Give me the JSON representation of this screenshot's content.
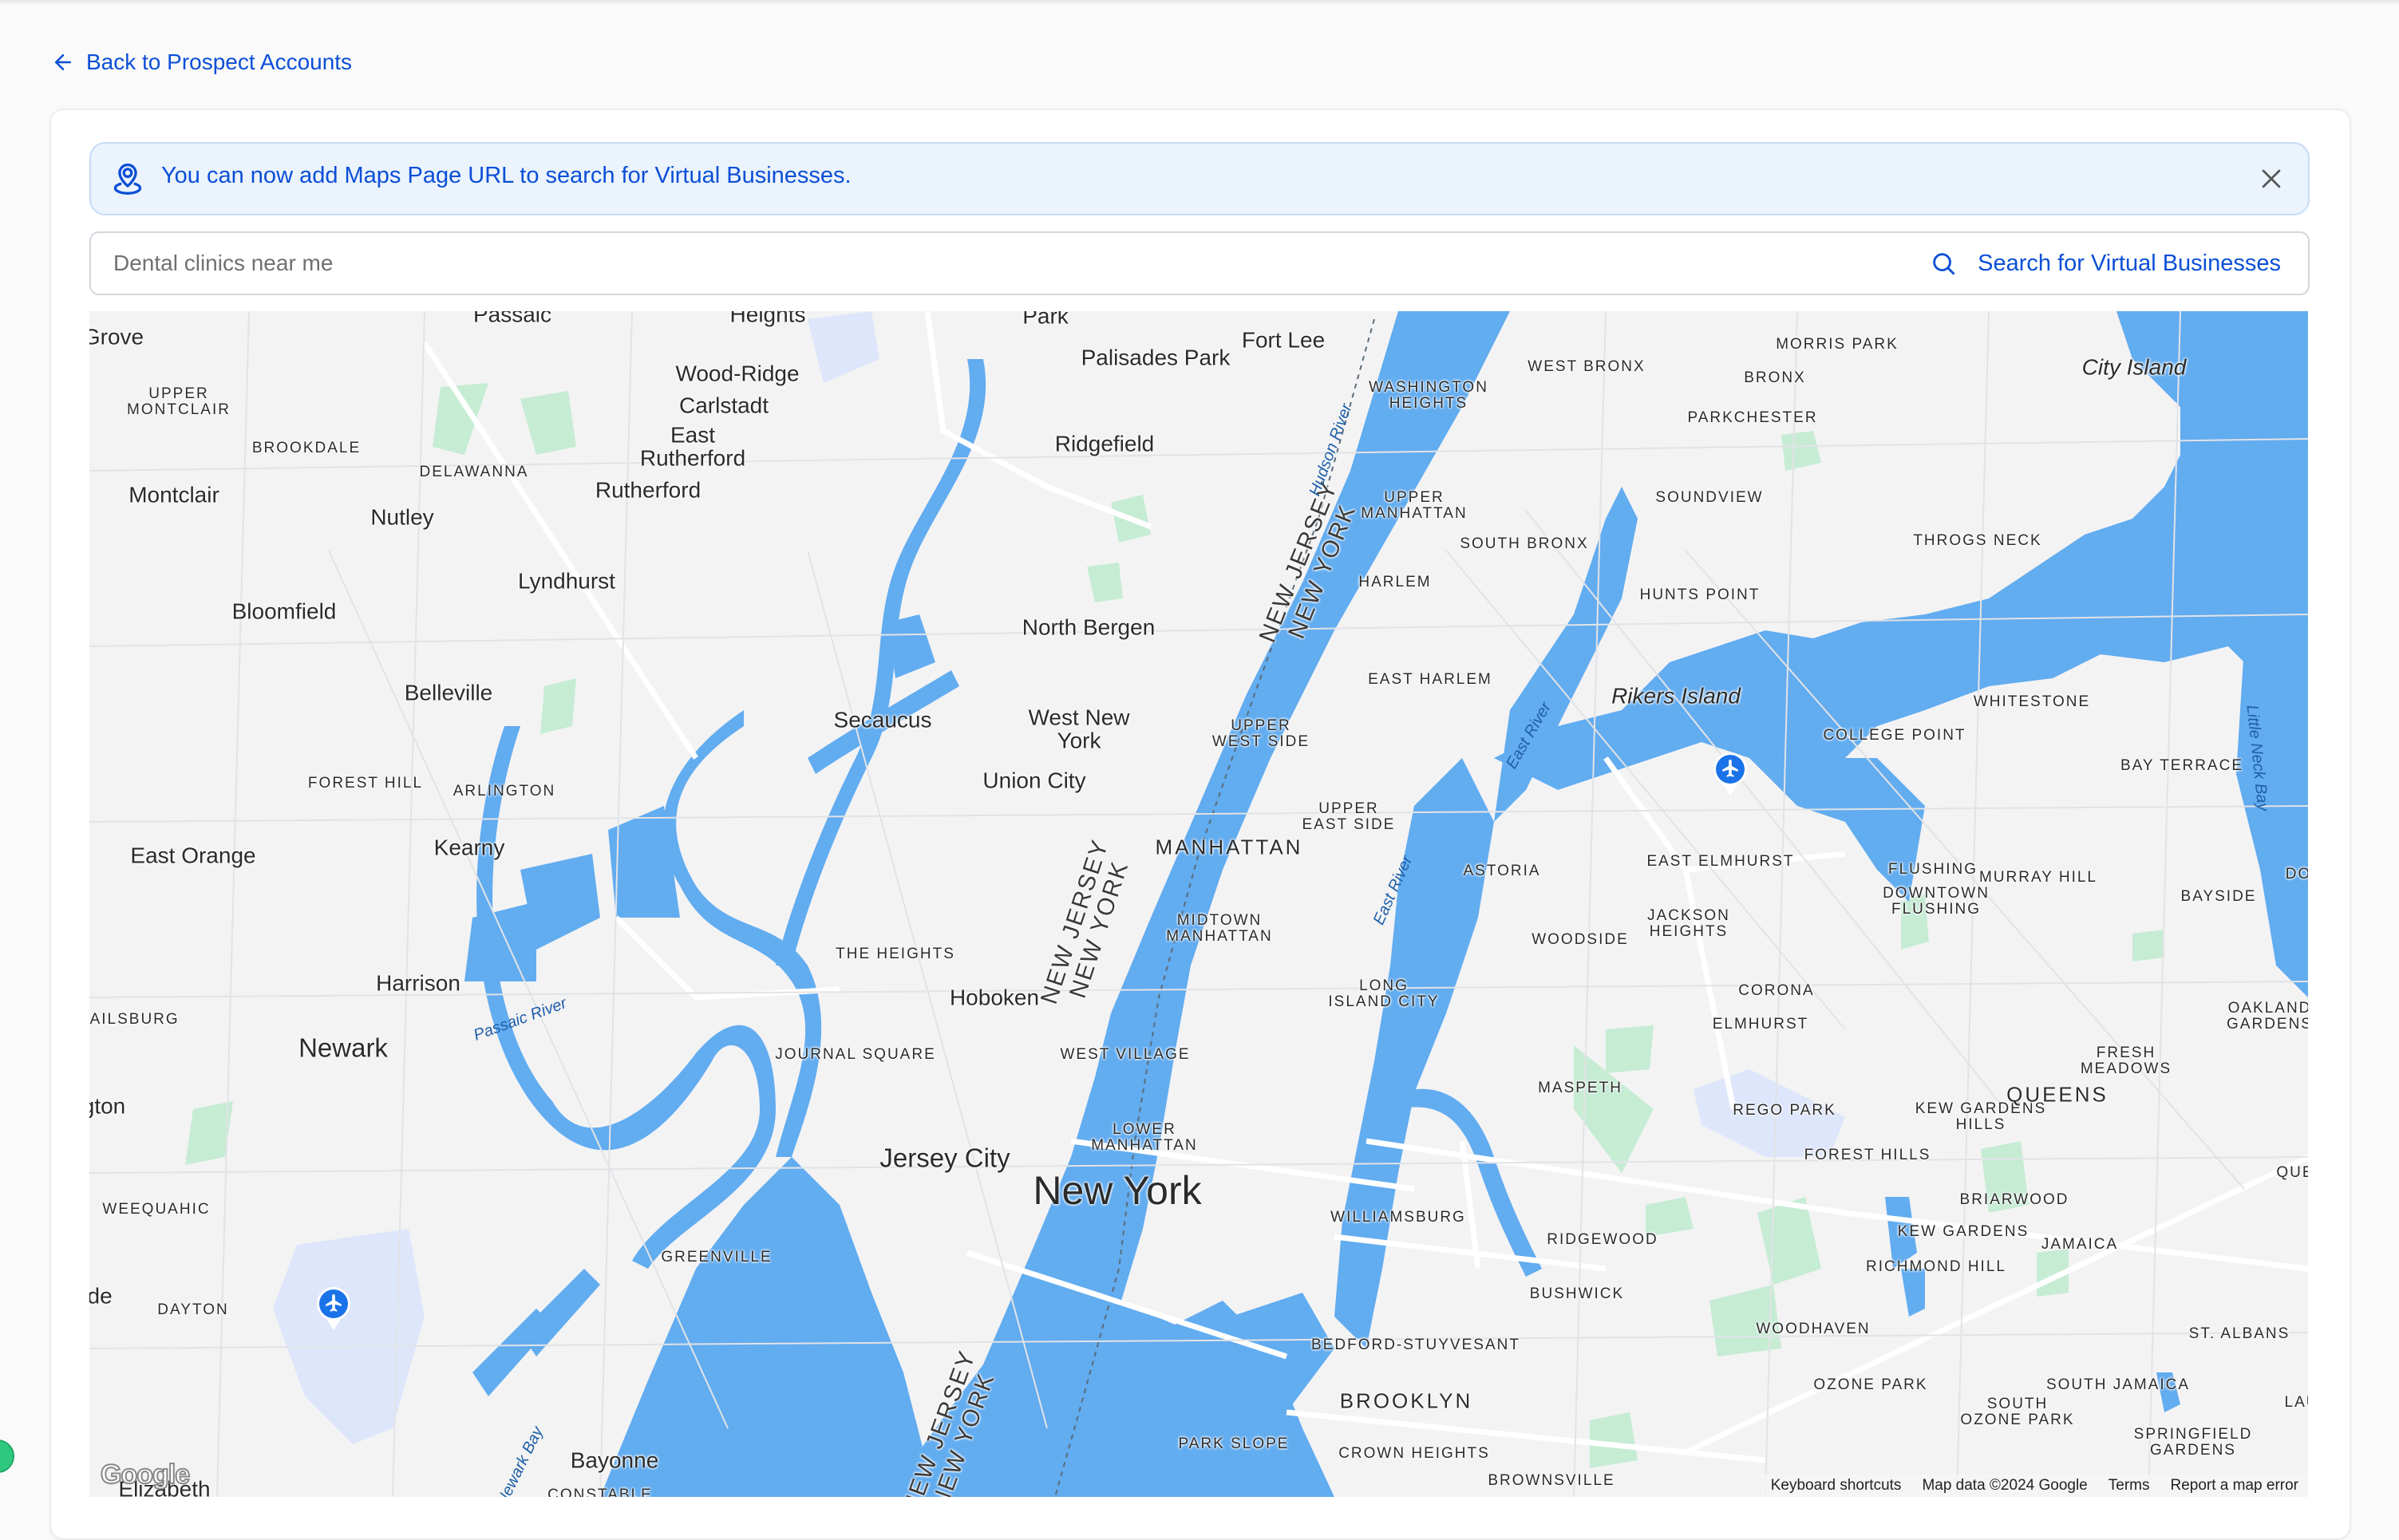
{
  "nav": {
    "back_label": "Back to Prospect Accounts"
  },
  "banner": {
    "message": "You can now add Maps Page URL to search for Virtual Businesses.",
    "icon": "map-pin-user-icon"
  },
  "search": {
    "value": "",
    "placeholder": "Dental clinics near me",
    "button_label": "Search for Virtual Businesses"
  },
  "colors": {
    "accent": "#0b4fd6",
    "banner_bg": "#ebf3fd",
    "water": "#62acf0",
    "land": "#f3f3f4",
    "park": "#c6ecd4",
    "airport": "#1a73e8"
  },
  "map": {
    "attribution": {
      "logo": "Google",
      "keyboard_shortcuts": "Keyboard shortcuts",
      "map_data": "Map data ©2024 Google",
      "terms": "Terms",
      "report": "Report a map error"
    },
    "labels": {
      "grove": "Grove",
      "passaic": "Passaic",
      "heights": "Heights",
      "park": "Park",
      "palisades_park": "Palisades Park",
      "fort_lee": "Fort Lee",
      "wood_ridge": "Wood-Ridge",
      "carlstadt": "Carlstadt",
      "east_rutherford": "East\nRutherford",
      "rutherford": "Rutherford",
      "ridgefield": "Ridgefield",
      "upper_montclair": "UPPER\nMONTCLAIR",
      "brookdale": "BROOKDALE",
      "delawanna": "DELAWANNA",
      "montclair": "Montclair",
      "nutley": "Nutley",
      "lyndhurst": "Lyndhurst",
      "bloomfield": "Bloomfield",
      "north_bergen": "North Bergen",
      "belleville": "Belleville",
      "secaucus": "Secaucus",
      "west_new_york": "West New\nYork",
      "union_city": "Union City",
      "forest_hill": "FOREST HILL",
      "arlington": "ARLINGTON",
      "east_orange": "East Orange",
      "kearny": "Kearny",
      "harrison": "Harrison",
      "newark": "Newark",
      "vailsburg": "VAILSBURG",
      "irvington": "gton",
      "the_heights": "THE HEIGHTS",
      "hoboken": "Hoboken",
      "journal_square": "JOURNAL SQUARE",
      "jersey_city": "Jersey City",
      "new_york": "New York",
      "weequahic": "WEEQUAHIC",
      "greenville": "GREENVILLE",
      "hillside": "ide",
      "dayton": "DAYTON",
      "bayonne": "Bayonne",
      "constable": "CONSTABLE",
      "elizabeth": "Elizabeth",
      "washington_heights": "WASHINGTON\nHEIGHTS",
      "upper_manhattan": "UPPER\nMANHATTAN",
      "harlem": "HARLEM",
      "east_harlem": "EAST HARLEM",
      "upper_west_side": "UPPER\nWEST SIDE",
      "upper_east_side": "UPPER\nEAST SIDE",
      "manhattan": "MANHATTAN",
      "midtown": "MIDTOWN\nMANHATTAN",
      "west_village": "WEST VILLAGE",
      "lower_manhattan": "LOWER\nMANHATTAN",
      "west_bronx": "WEST BRONX",
      "morris_park": "MORRIS PARK",
      "bronx": "BRONX",
      "parkchester": "PARKCHESTER",
      "soundview": "SOUNDVIEW",
      "south_bronx": "SOUTH BRONX",
      "hunts_point": "HUNTS POINT",
      "throgs_neck": "THROGS NECK",
      "city_island": "City Island",
      "rikers_island": "Rikers Island",
      "whitestone": "WHITESTONE",
      "college_point": "COLLEGE POINT",
      "bay_terrace": "BAY TERRACE",
      "astoria": "ASTORIA",
      "east_elmhurst": "EAST ELMHURST",
      "flushing": "FLUSHING",
      "downtown_flushing": "DOWNTOWN\nFLUSHING",
      "murray_hill": "MURRAY HILL",
      "bayside": "BAYSIDE",
      "douglaston": "DO",
      "woodside": "WOODSIDE",
      "jackson_heights": "JACKSON\nHEIGHTS",
      "long_island_city": "LONG\nISLAND CITY",
      "corona": "CORONA",
      "elmhurst": "ELMHURST",
      "oakland_gardens": "OAKLAND\nGARDENS",
      "fresh_meadows": "FRESH\nMEADOWS",
      "maspeth": "MASPETH",
      "rego_park": "REGO PARK",
      "kew_gardens_hills": "KEW GARDENS\nHILLS",
      "queens": "QUEENS",
      "forest_hills": "FOREST HILLS",
      "queens_village": "QUE",
      "williamsburg": "WILLIAMSBURG",
      "briarwood": "BRIARWOOD",
      "ridgewood": "RIDGEWOOD",
      "kew_gardens": "KEW GARDENS",
      "jamaica": "JAMAICA",
      "richmond_hill": "RICHMOND HILL",
      "bushwick": "BUSHWICK",
      "woodhaven": "WOODHAVEN",
      "st_albans": "ST. ALBANS",
      "bed_stuy": "BEDFORD-STUYVESANT",
      "brooklyn": "BROOKLYN",
      "ozone_park": "OZONE PARK",
      "south_jamaica": "SOUTH JAMAICA",
      "south_ozone_park": "SOUTH\nOZONE PARK",
      "park_slope": "PARK SLOPE",
      "crown_heights": "CROWN HEIGHTS",
      "springfield_gardens": "SPRINGFIELD\nGARDENS",
      "brownsville": "BROWNSVILLE",
      "laurelton": "LAU",
      "nj_ny_1": "NEW JERSEY\nNEW YORK",
      "nj_ny_2": "NEW JERSEY\nNEW YORK",
      "nj_ny_3": "NEW JERSEY\nNEW YORK",
      "hudson_river": "Hudson River",
      "east_river_1": "East River",
      "east_river_2": "East River",
      "passaic_river": "Passaic River",
      "newark_bay": "Newark Bay",
      "little_neck_bay": "Little Neck Bay"
    }
  }
}
